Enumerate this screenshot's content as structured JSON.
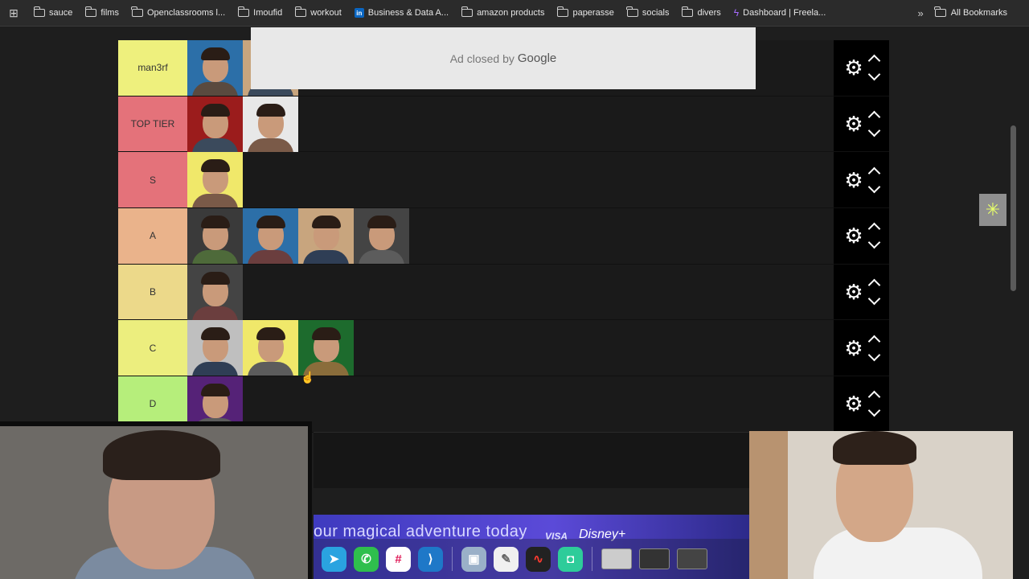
{
  "bookmarks": [
    {
      "label": "sauce",
      "icon": "folder-icon"
    },
    {
      "label": "films",
      "icon": "folder-icon"
    },
    {
      "label": "Openclassrooms l...",
      "icon": "folder-icon"
    },
    {
      "label": "Imoufid",
      "icon": "folder-icon"
    },
    {
      "label": "workout",
      "icon": "folder-icon"
    },
    {
      "label": "Business & Data A...",
      "icon": "linkedin-icon"
    },
    {
      "label": "amazon products",
      "icon": "folder-icon"
    },
    {
      "label": "paperasse",
      "icon": "folder-icon"
    },
    {
      "label": "socials",
      "icon": "folder-icon"
    },
    {
      "label": "divers",
      "icon": "folder-icon"
    },
    {
      "label": "Dashboard | Freela...",
      "icon": "dashboard-icon"
    }
  ],
  "all_bookmarks": "All Bookmarks",
  "ad": {
    "closed_text": "Ad closed by",
    "brand": "Google"
  },
  "tiers": [
    {
      "label": "man3rf",
      "color": "#eef07d",
      "items": 2
    },
    {
      "label": "TOP TIER",
      "color": "#e4727a",
      "items": 2
    },
    {
      "label": "S",
      "color": "#e4727a",
      "items": 1
    },
    {
      "label": "A",
      "color": "#eab38b",
      "items": 4
    },
    {
      "label": "B",
      "color": "#ecd98a",
      "items": 1
    },
    {
      "label": "C",
      "color": "#ecee7e",
      "items": 3
    },
    {
      "label": "D",
      "color": "#b6ee7b",
      "items": 1
    }
  ],
  "banner": {
    "text": "our magical adventure today",
    "brand1": "VISA",
    "brand2": "Disney+"
  },
  "dock": [
    "telegram-icon",
    "whatsapp-icon",
    "slack-icon",
    "vscode-icon",
    "preview-icon",
    "notes-icon",
    "voice-memos-icon",
    "streamlabs-icon"
  ]
}
